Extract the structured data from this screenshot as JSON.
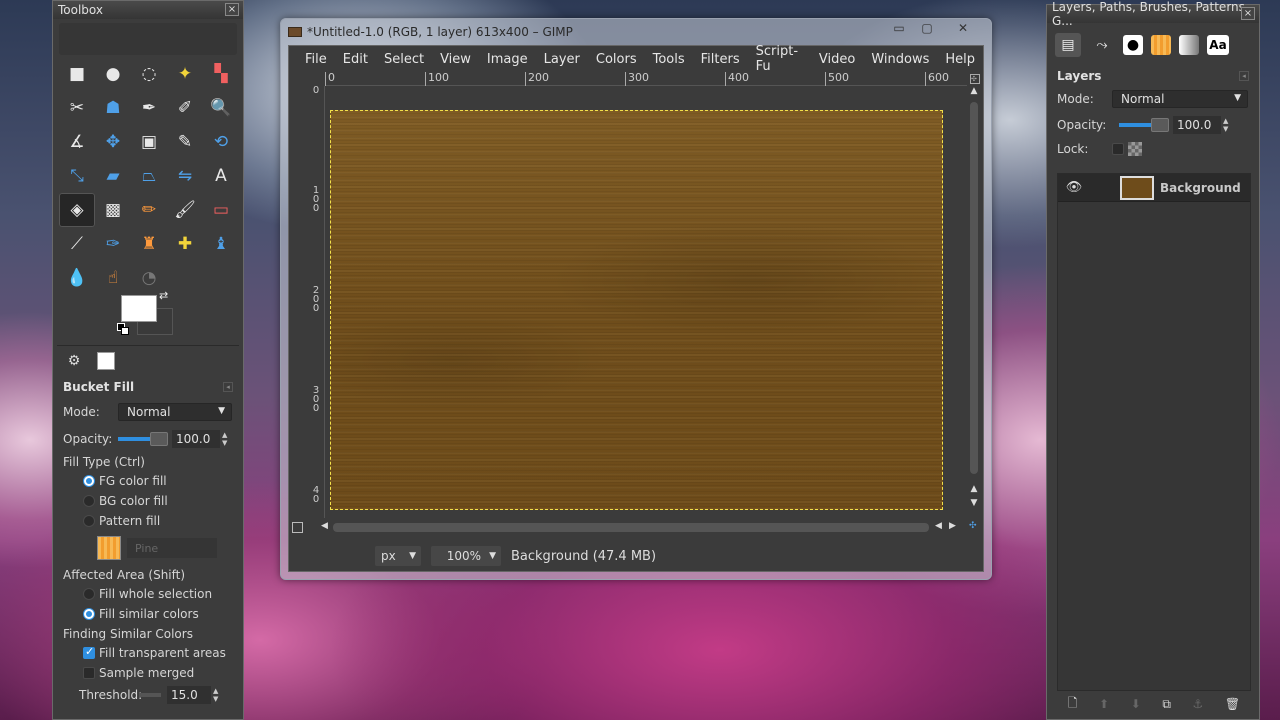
{
  "toolbox": {
    "title": "Toolbox",
    "close_glyph": "×",
    "tools": [
      {
        "icon": "rect-select-icon",
        "glyph": "■",
        "cls": ""
      },
      {
        "icon": "ellipse-select-icon",
        "glyph": "●",
        "cls": ""
      },
      {
        "icon": "free-select-icon",
        "glyph": "◌",
        "cls": ""
      },
      {
        "icon": "fuzzy-select-icon",
        "glyph": "✦",
        "cls": "yellow"
      },
      {
        "icon": "select-by-color-icon",
        "glyph": "▚",
        "cls": "red"
      },
      {
        "icon": "scissors-select-icon",
        "glyph": "✂",
        "cls": ""
      },
      {
        "icon": "foreground-select-icon",
        "glyph": "☗",
        "cls": "blue"
      },
      {
        "icon": "paths-icon",
        "glyph": "✒",
        "cls": ""
      },
      {
        "icon": "color-picker-icon",
        "glyph": "✐",
        "cls": ""
      },
      {
        "icon": "zoom-icon",
        "glyph": "🔍",
        "cls": "blue"
      },
      {
        "icon": "measure-icon",
        "glyph": "∡",
        "cls": ""
      },
      {
        "icon": "move-icon",
        "glyph": "✥",
        "cls": "blue"
      },
      {
        "icon": "align-icon",
        "glyph": "▣",
        "cls": ""
      },
      {
        "icon": "crop-icon",
        "glyph": "✎",
        "cls": ""
      },
      {
        "icon": "rotate-icon",
        "glyph": "⟲",
        "cls": "blue"
      },
      {
        "icon": "scale-icon",
        "glyph": "⤡",
        "cls": "blue"
      },
      {
        "icon": "shear-icon",
        "glyph": "▰",
        "cls": "blue"
      },
      {
        "icon": "perspective-icon",
        "glyph": "⏢",
        "cls": "blue"
      },
      {
        "icon": "flip-icon",
        "glyph": "⇋",
        "cls": "blue"
      },
      {
        "icon": "text-icon",
        "glyph": "A",
        "cls": ""
      },
      {
        "icon": "bucket-fill-icon",
        "glyph": "◈",
        "cls": "active"
      },
      {
        "icon": "blend-icon",
        "glyph": "▩",
        "cls": ""
      },
      {
        "icon": "pencil-icon",
        "glyph": "✏",
        "cls": "orange"
      },
      {
        "icon": "paintbrush-icon",
        "glyph": "🖌",
        "cls": ""
      },
      {
        "icon": "eraser-icon",
        "glyph": "▭",
        "cls": "red"
      },
      {
        "icon": "airbrush-icon",
        "glyph": "⟋",
        "cls": ""
      },
      {
        "icon": "ink-icon",
        "glyph": "✑",
        "cls": "blue"
      },
      {
        "icon": "clone-icon",
        "glyph": "♜",
        "cls": "orange"
      },
      {
        "icon": "heal-icon",
        "glyph": "✚",
        "cls": "yellow"
      },
      {
        "icon": "perspective-clone-icon",
        "glyph": "♝",
        "cls": "blue"
      },
      {
        "icon": "blur-icon",
        "glyph": "💧",
        "cls": "blue"
      },
      {
        "icon": "smudge-icon",
        "glyph": "☝",
        "cls": "orange"
      },
      {
        "icon": "dodge-burn-icon",
        "glyph": "◔",
        "cls": "dim"
      }
    ],
    "fg_color": "#ffffff",
    "bg_color": "#3a3a3a",
    "swap_glyph": "⇄"
  },
  "tool_options": {
    "heading": "Bucket Fill",
    "menu_glyph": "◂",
    "mode_label": "Mode:",
    "mode_value": "Normal",
    "opacity_label": "Opacity:",
    "opacity_value": "100.0",
    "opacity_fraction": 1.0,
    "fill_type_label": "Fill Type  (Ctrl)",
    "fill_types": [
      {
        "label": "FG color fill",
        "on": true
      },
      {
        "label": "BG color fill",
        "on": false
      },
      {
        "label": "Pattern fill",
        "on": false
      }
    ],
    "pattern_name": "Pine",
    "affected_label": "Affected Area  (Shift)",
    "affected": [
      {
        "label": "Fill whole selection",
        "on": false
      },
      {
        "label": "Fill similar colors",
        "on": true
      }
    ],
    "finding_label": "Finding Similar Colors",
    "finding_checks": [
      {
        "label": "Fill transparent areas",
        "on": true
      },
      {
        "label": "Sample merged",
        "on": false
      }
    ],
    "threshold_label": "Threshold:",
    "threshold_value": "15.0"
  },
  "image_window": {
    "title": "*Untitled-1.0 (RGB, 1 layer) 613x400 – GIMP",
    "minimize_glyph": "▭",
    "maximize_glyph": "▢",
    "close_glyph": "✕",
    "menus": [
      "File",
      "Edit",
      "Select",
      "View",
      "Image",
      "Layer",
      "Colors",
      "Tools",
      "Filters",
      "Script-Fu",
      "Video",
      "Windows",
      "Help"
    ],
    "ruler_h": [
      "0",
      "100",
      "200",
      "300",
      "400",
      "500",
      "600"
    ],
    "ruler_v": [
      "0",
      "100",
      "200",
      "300",
      "40"
    ],
    "unit": "px",
    "zoom": "100%",
    "status": "Background (47.4 MB)"
  },
  "layers_dock": {
    "title": "Layers, Paths, Brushes, Patterns, G...",
    "close_glyph": "×",
    "panel_title": "Layers",
    "mode_label": "Mode:",
    "mode_value": "Normal",
    "opacity_label": "Opacity:",
    "opacity_value": "100.0",
    "opacity_fraction": 1.0,
    "lock_label": "Lock:",
    "layers": [
      {
        "name": "Background",
        "visible": true,
        "color": "#6e4c1b"
      }
    ]
  }
}
